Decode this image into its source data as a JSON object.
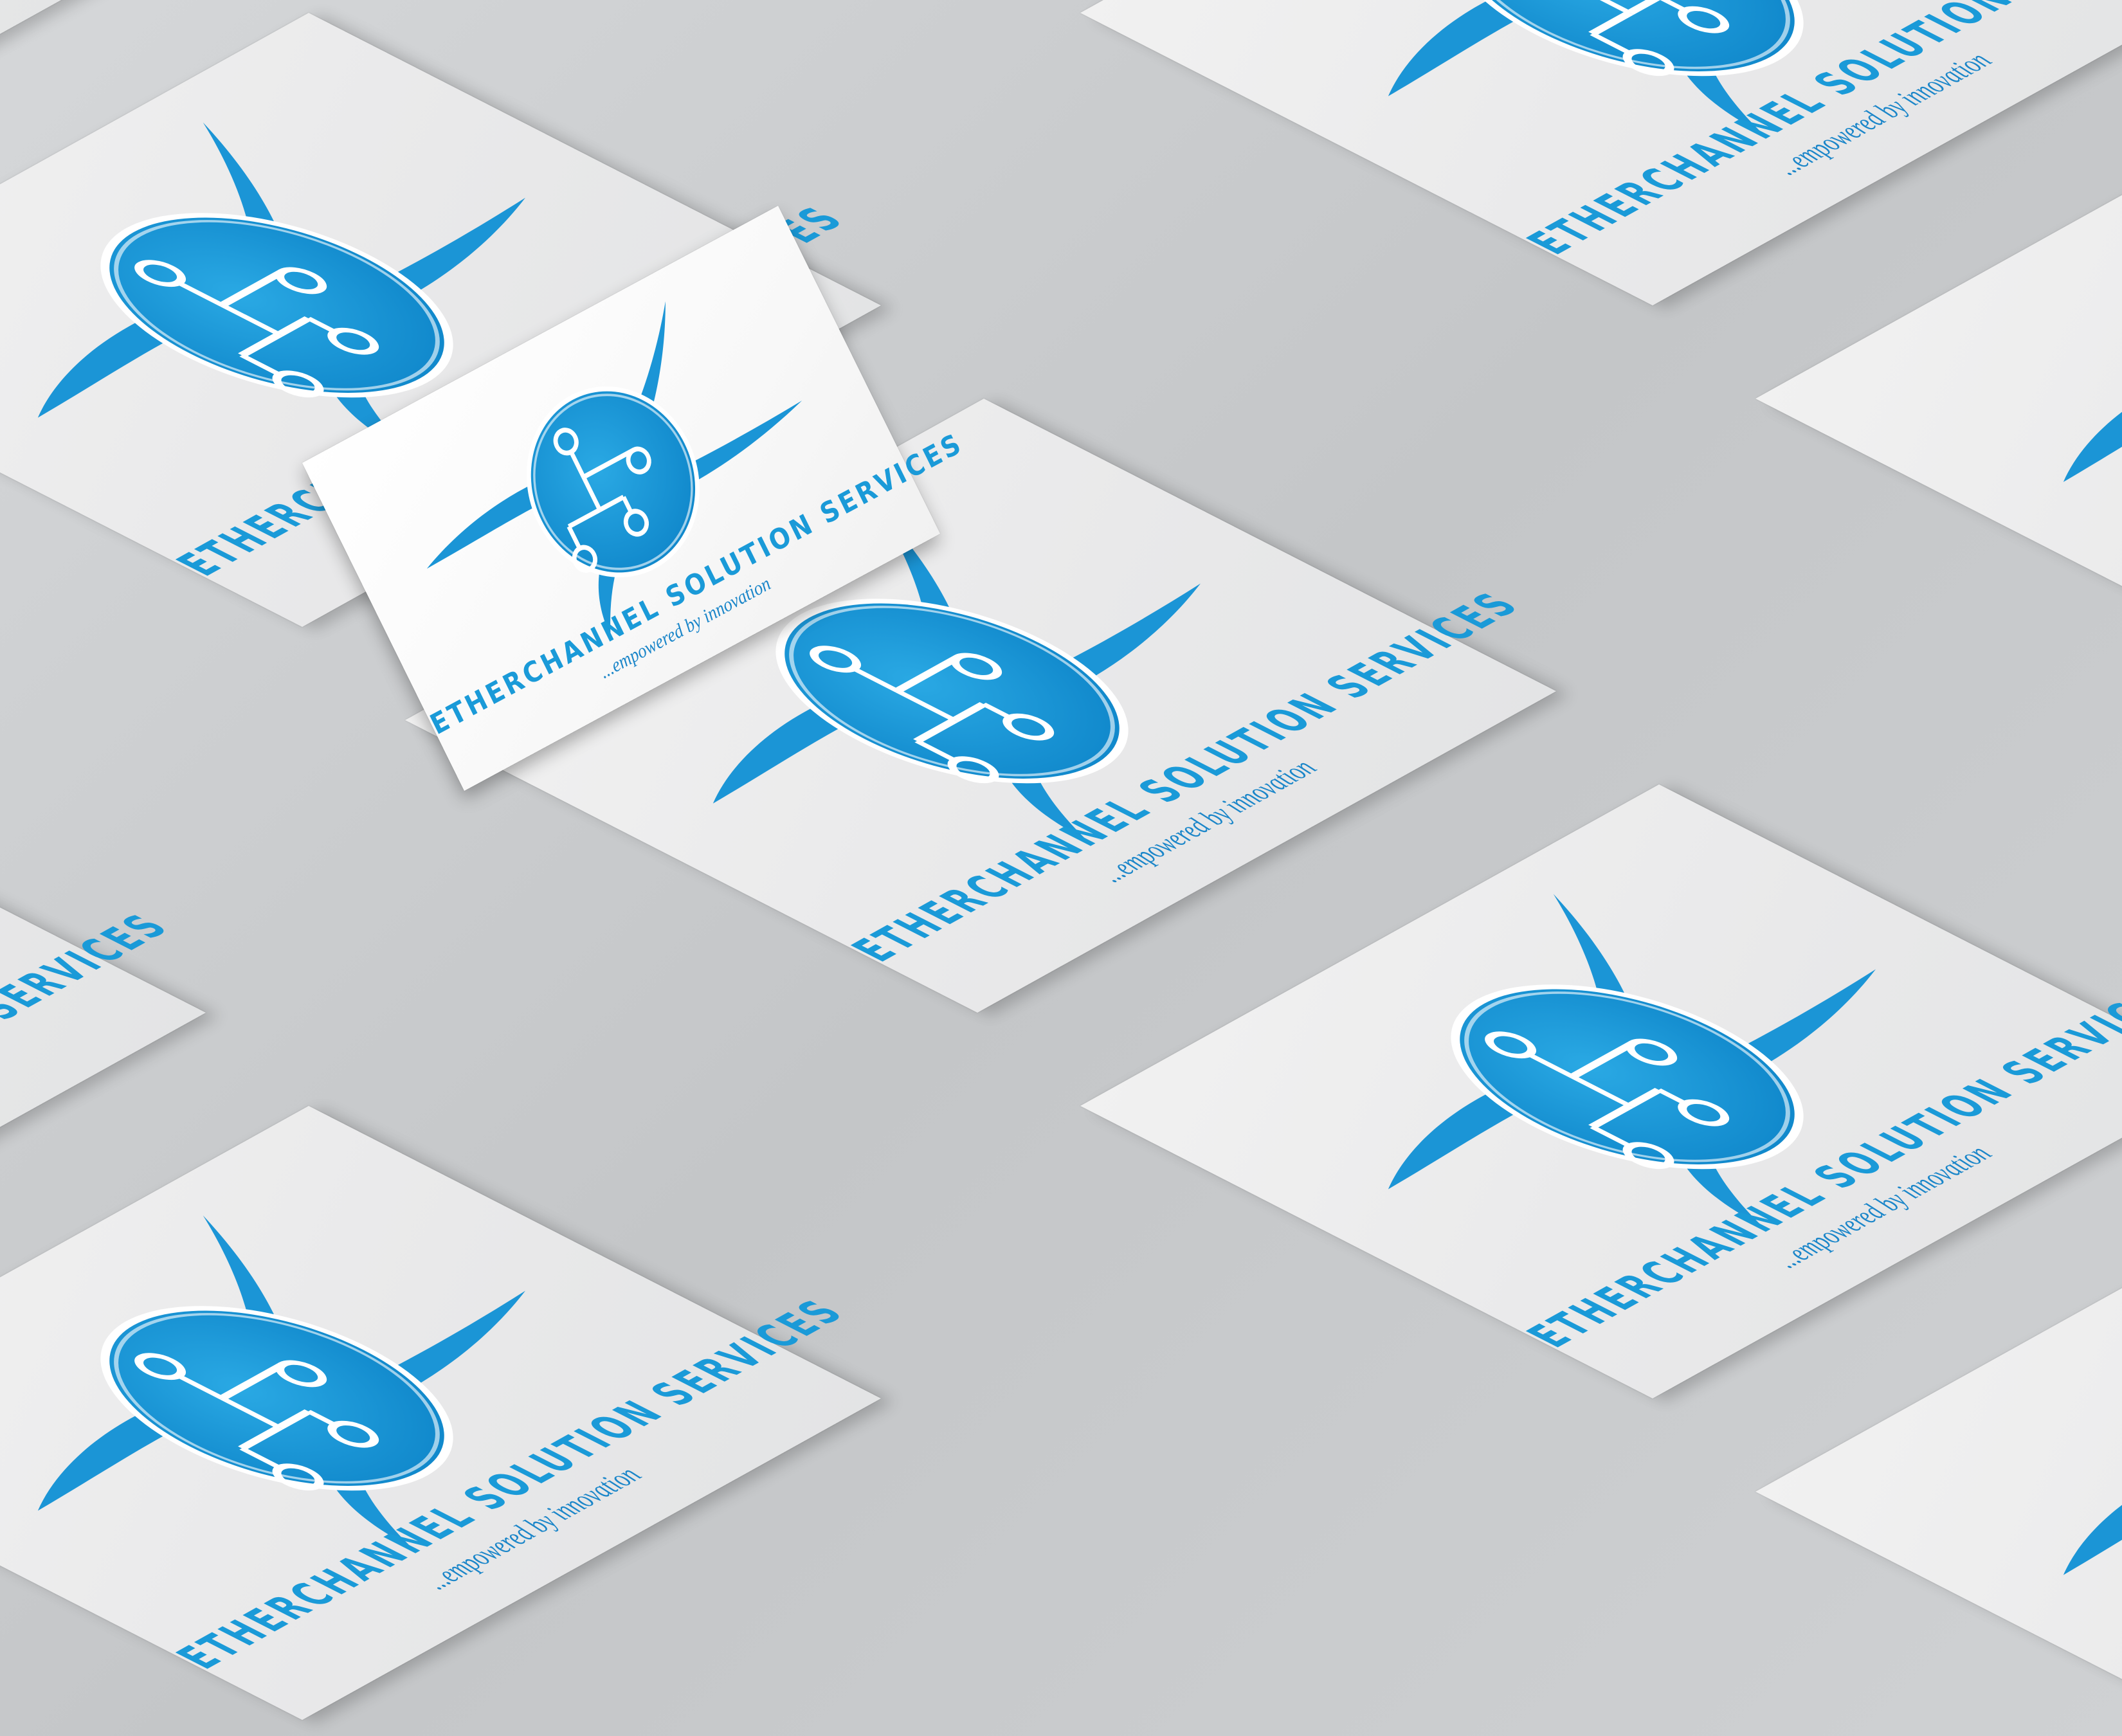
{
  "brand": {
    "company_name": "ETHERCHANNEL SOLUTION SERVICES",
    "tagline": "...empowered by  innovation",
    "logo_icon": "network-hierarchy-icon",
    "colors": {
      "primary_blue": "#1a9ad8",
      "card_white": "#f4f4f4",
      "background_gray": "#cfd1d3"
    }
  }
}
